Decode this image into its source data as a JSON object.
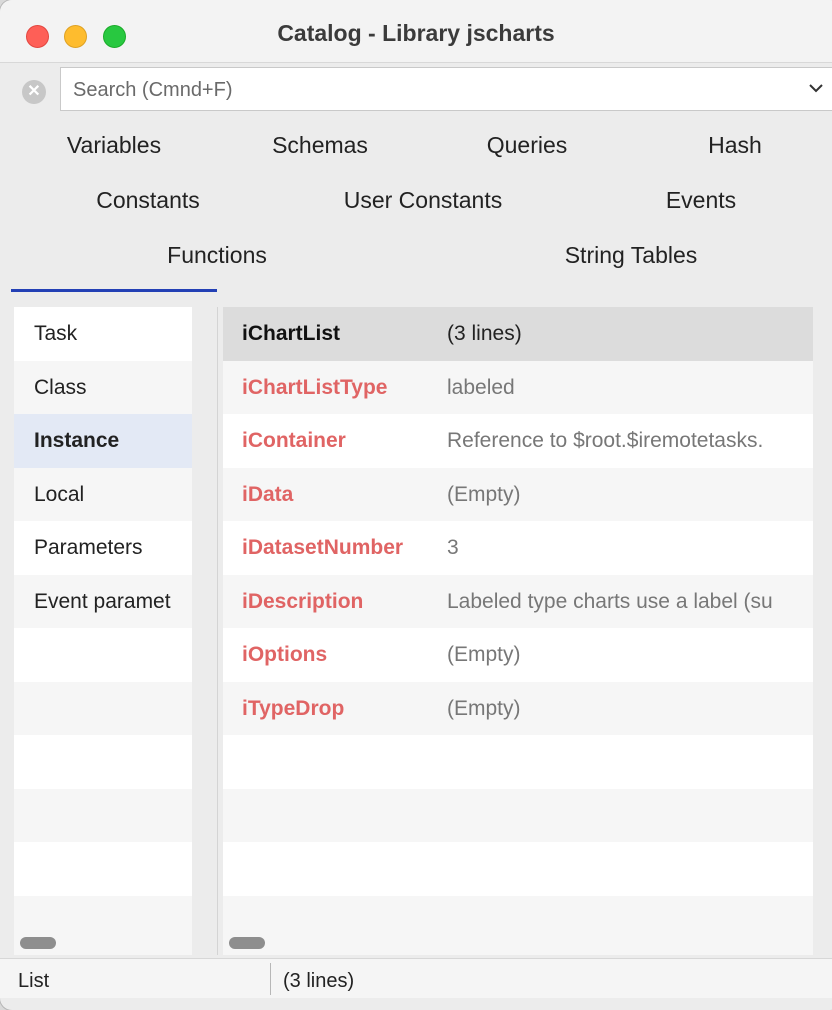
{
  "window": {
    "title": "Catalog - Library jscharts"
  },
  "search": {
    "placeholder": "Search (Cmnd+F)"
  },
  "tabs": [
    {
      "label": "Variables",
      "selected": true
    },
    {
      "label": "Schemas"
    },
    {
      "label": "Queries"
    },
    {
      "label": "Hash"
    },
    {
      "label": "Constants"
    },
    {
      "label": "User Constants"
    },
    {
      "label": "Events"
    },
    {
      "label": "Functions"
    },
    {
      "label": "String Tables"
    }
  ],
  "sidebar": {
    "items": [
      {
        "label": "Task"
      },
      {
        "label": "Class"
      },
      {
        "label": "Instance",
        "selected": true
      },
      {
        "label": "Local"
      },
      {
        "label": "Parameters"
      },
      {
        "label": "Event paramet"
      }
    ]
  },
  "variables": [
    {
      "name": "iChartList",
      "value": "(3 lines)",
      "selected": true
    },
    {
      "name": "iChartListType",
      "value": "labeled"
    },
    {
      "name": "iContainer",
      "value": "Reference to $root.$iremotetasks."
    },
    {
      "name": "iData",
      "value": "(Empty)"
    },
    {
      "name": "iDatasetNumber",
      "value": "3"
    },
    {
      "name": "iDescription",
      "value": "Labeled type charts use a label (su"
    },
    {
      "name": "iOptions",
      "value": "(Empty)"
    },
    {
      "name": "iTypeDrop",
      "value": "(Empty)"
    }
  ],
  "status": {
    "type": "List",
    "value": "(3 lines)"
  },
  "colors": {
    "variable_name": "#e06464",
    "tab_underline": "#2340b5",
    "selected_sidebar": "#e3e9f5",
    "selected_row": "#dcdcdc"
  },
  "icons": {
    "clear": "clear-search-icon",
    "dropdown": "chevron-down-icon"
  }
}
